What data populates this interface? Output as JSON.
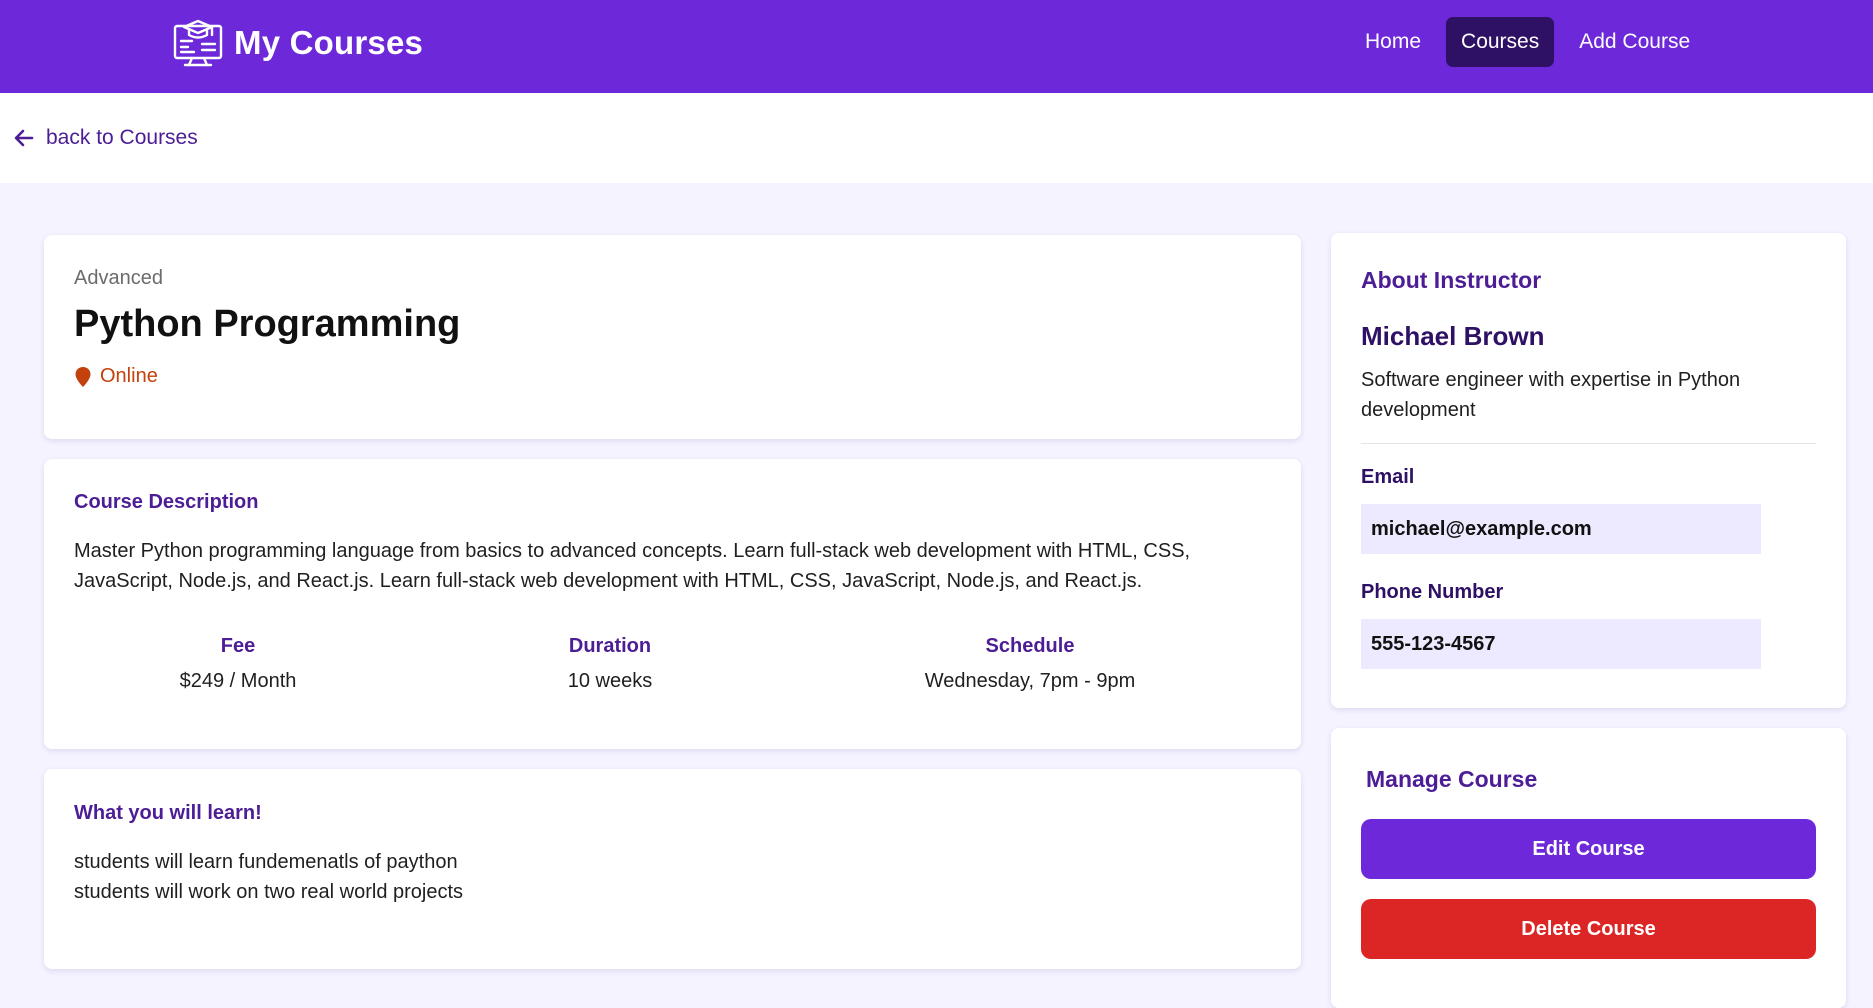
{
  "header": {
    "brand_title": "My Courses",
    "brand_icon": "classroom-screen-icon",
    "nav": [
      {
        "label": "Home",
        "active": false
      },
      {
        "label": "Courses",
        "active": true
      },
      {
        "label": "Add Course",
        "active": false
      }
    ]
  },
  "back": {
    "label": "back to Courses",
    "icon": "arrow-left-icon"
  },
  "course": {
    "level": "Advanced",
    "title": "Python Programming",
    "location": "Online",
    "location_icon": "map-pin-icon"
  },
  "description": {
    "heading": "Course Description",
    "text": "Master Python programming language from basics to advanced concepts. Learn full-stack web development with HTML, CSS, JavaScript, Node.js, and React.js. Learn full-stack web development with HTML, CSS, JavaScript, Node.js, and React.js.",
    "stats": [
      {
        "label": "Fee",
        "value": "$249 / Month"
      },
      {
        "label": "Duration",
        "value": "10 weeks"
      },
      {
        "label": "Schedule",
        "value": "Wednesday, 7pm - 9pm"
      }
    ]
  },
  "learn": {
    "heading": "What you will learn!",
    "items": [
      "students will learn fundemenatls of paython",
      "students will work on two real world projects"
    ]
  },
  "instructor": {
    "heading": "About Instructor",
    "name": "Michael Brown",
    "bio": "Software engineer with expertise in Python development",
    "email_label": "Email",
    "email": "michael@example.com",
    "phone_label": "Phone Number",
    "phone": "555-123-4567"
  },
  "manage": {
    "heading": "Manage Course",
    "edit_label": "Edit Course",
    "delete_label": "Delete Course"
  },
  "colors": {
    "primary": "#6d28d9",
    "dark_purple": "#2e1065",
    "heading_purple": "#4c1d95",
    "danger": "#dc2626",
    "location": "#c2410c",
    "page_bg": "#f5f3ff",
    "field_bg": "#ede9fe"
  }
}
